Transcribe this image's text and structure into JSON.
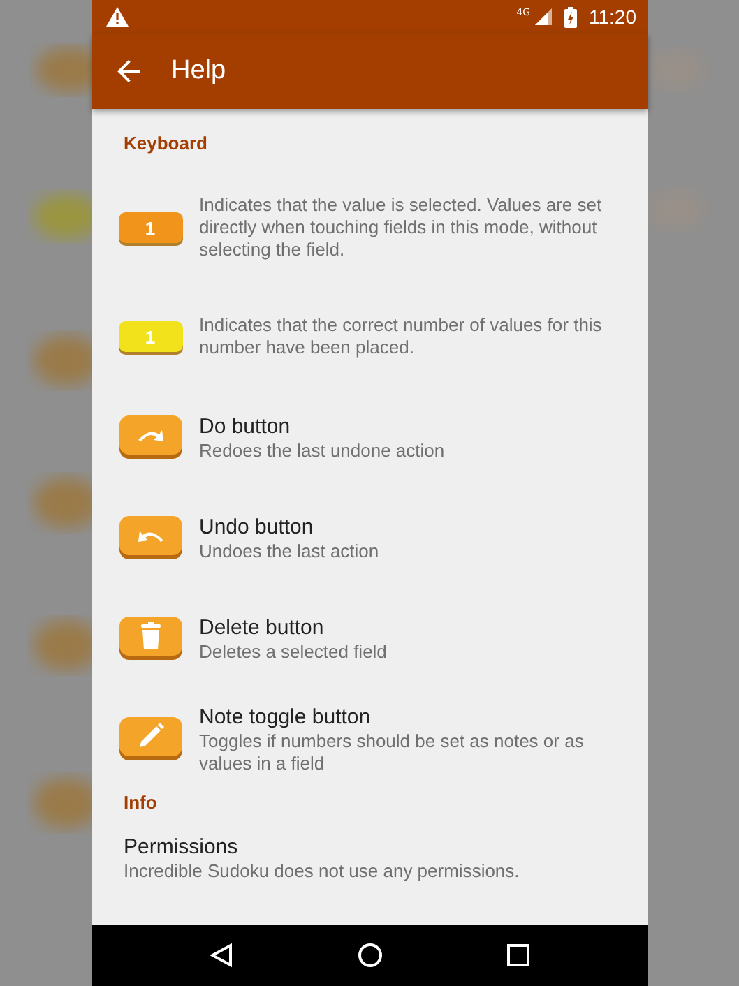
{
  "status_bar": {
    "network": "4G",
    "time": "11:20"
  },
  "app_bar": {
    "title": "Help"
  },
  "sections": [
    {
      "header": "Keyboard",
      "items": [
        {
          "kind": "key",
          "key_label": "1",
          "color": "#f1941c",
          "description": "Indicates that the value is selected. Values are set directly when touching fields in this mode, without selecting the field."
        },
        {
          "kind": "key",
          "key_label": "1",
          "color": "#f2e21c",
          "description": "Indicates that the correct number of values for this number have been placed."
        },
        {
          "kind": "redo",
          "title": "Do button",
          "description": "Redoes the last undone action"
        },
        {
          "kind": "undo",
          "title": "Undo button",
          "description": "Undoes the last action"
        },
        {
          "kind": "delete",
          "title": "Delete button",
          "description": "Deletes a selected field"
        },
        {
          "kind": "note",
          "title": "Note toggle button",
          "description": "Toggles if numbers should be set as notes or as values in a field"
        }
      ]
    },
    {
      "header": "Info",
      "items": [
        {
          "kind": "text",
          "title": "Permissions",
          "description": "Incredible Sudoku does not use any permissions."
        }
      ]
    }
  ]
}
